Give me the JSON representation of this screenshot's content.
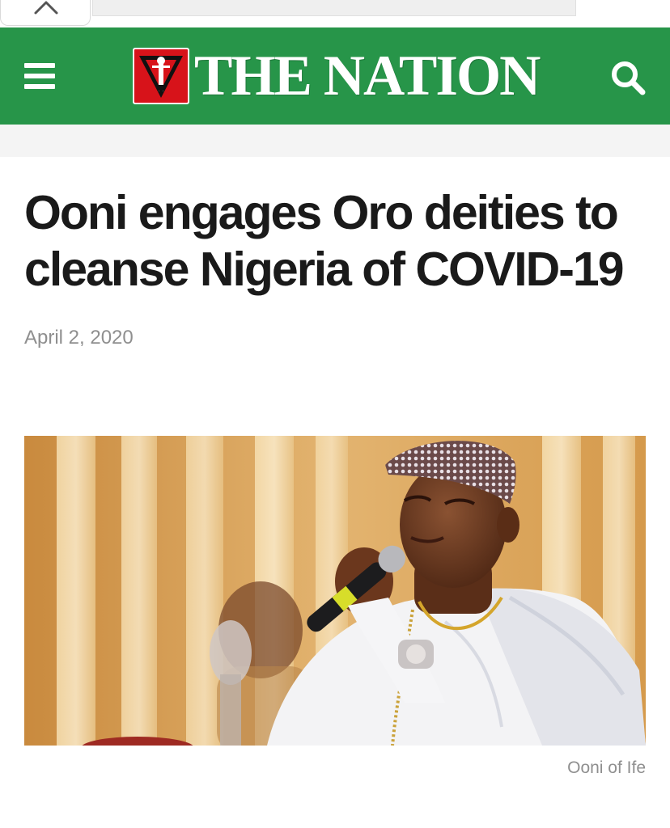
{
  "site": {
    "name": "THE NATION",
    "brand_color": "#279549",
    "logo_red": "#d7131a"
  },
  "icons": {
    "collapse": "chevron-up-icon",
    "menu": "hamburger-menu-icon",
    "search": "search-icon"
  },
  "article": {
    "headline": "Ooni engages Oro deities to cleanse Nigeria of COVID-19",
    "date": "April 2, 2020",
    "image_caption": "Ooni of Ife"
  }
}
